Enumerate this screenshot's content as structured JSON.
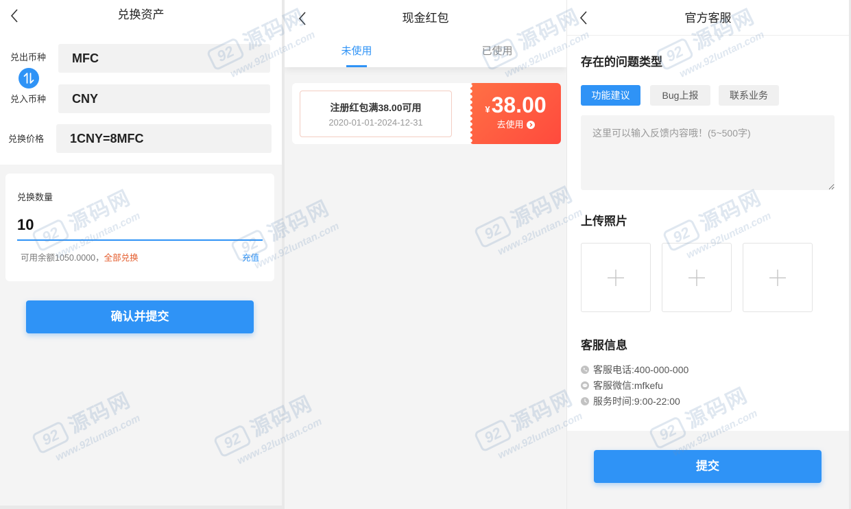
{
  "colors": {
    "accent": "#2f93f6",
    "warning": "#e45c2c",
    "coupon_start": "#ff7045",
    "coupon_end": "#ff4a3d"
  },
  "watermark": {
    "logo": "92",
    "name": "源码网",
    "url": "www.92luntan.com"
  },
  "exchange": {
    "title": "兑换资产",
    "from": {
      "label": "兑出币种",
      "value": "MFC"
    },
    "to": {
      "label": "兑入币种",
      "value": "CNY"
    },
    "price": {
      "label": "兑换价格",
      "value": "1CNY=8MFC"
    },
    "amount": {
      "label": "兑换数量",
      "value": "10",
      "balance_label": "可用余额",
      "balance_value": "1050.0000",
      "balance_sep": "，",
      "all_label": "全部兑换",
      "recharge_label": "充值"
    },
    "submit_label": "确认并提交"
  },
  "red_packet": {
    "title": "现金红包",
    "tabs": [
      {
        "label": "未使用",
        "active": true
      },
      {
        "label": "已使用",
        "active": false
      }
    ],
    "coupons": [
      {
        "name": "注册红包满38.00可用",
        "validity": "2020-01-01-2024-12-31",
        "currency": "¥",
        "amount": "38.00",
        "action_label": "去使用"
      }
    ]
  },
  "support": {
    "title": "官方客服",
    "issue_heading": "存在的问题类型",
    "issue_types": [
      {
        "label": "功能建议",
        "selected": true
      },
      {
        "label": "Bug上报",
        "selected": false
      },
      {
        "label": "联系业务",
        "selected": false
      }
    ],
    "feedback": {
      "placeholder": "这里可以输入反馈内容哦！(5~500字)"
    },
    "upload_heading": "上传照片",
    "upload_slots": [
      {
        "icon": "plus-icon"
      },
      {
        "icon": "plus-icon"
      },
      {
        "icon": "plus-icon"
      }
    ],
    "info_heading": "客服信息",
    "info": [
      {
        "icon": "phone-icon",
        "text": "客服电话:400-000-000"
      },
      {
        "icon": "wechat-icon",
        "text": "客服微信:mfkefu"
      },
      {
        "icon": "clock-icon",
        "text": "服务时间:9:00-22:00"
      }
    ],
    "submit_label": "提交"
  }
}
